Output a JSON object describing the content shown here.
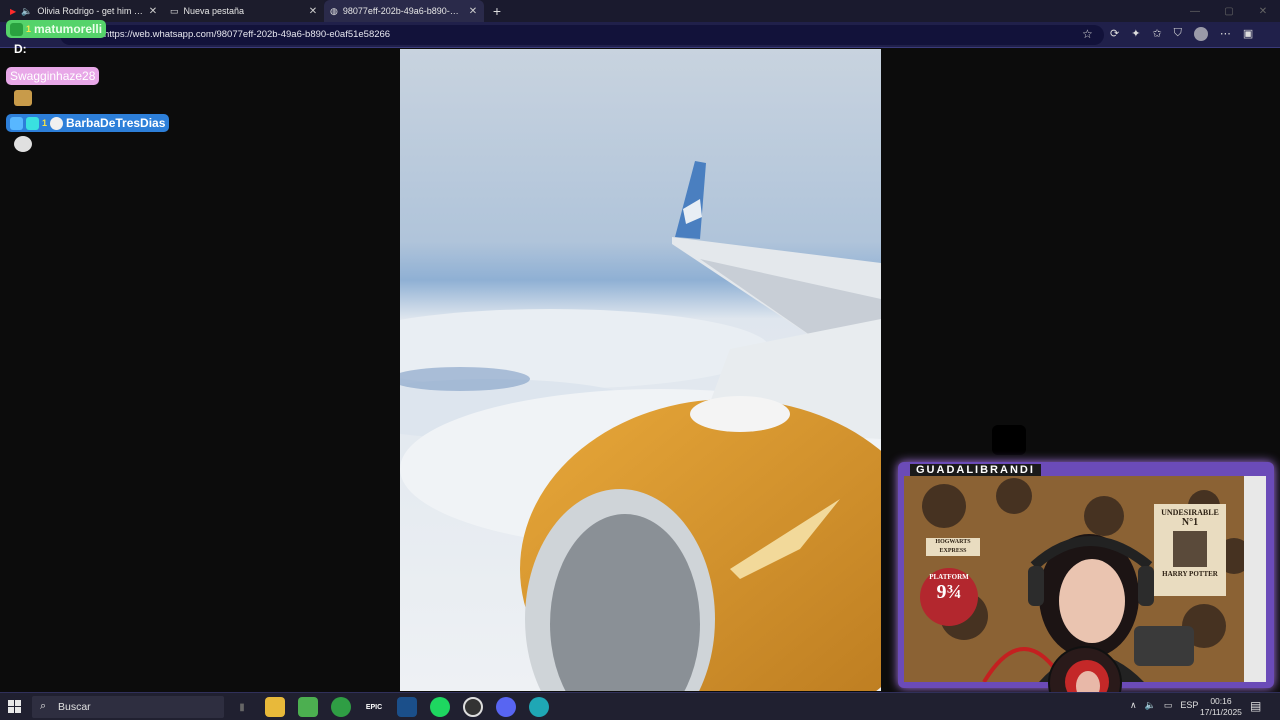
{
  "browser": {
    "tabs": [
      {
        "title": "Olivia Rodrigo - get him bac",
        "favicon": "youtube-icon",
        "audio": true
      },
      {
        "title": "Nueva pestaña",
        "favicon": "newtab-icon"
      },
      {
        "title": "98077eff-202b-49a6-b890-e0af5",
        "favicon": "globe-icon"
      }
    ],
    "new_tab": "+",
    "url": "https://web.whatsapp.com/98077eff-202b-49a6-b890-e0af51e58266"
  },
  "chat": {
    "top_marker": "D:",
    "messages": [
      {
        "user": "matumorelli",
        "badge_count": "1",
        "color": "#55d36a"
      },
      {
        "user": "Swagginhaze28",
        "color": "#e8a8e8"
      },
      {
        "user": "BarbaDeTresDias",
        "badge_count": "1",
        "color": "#2d7fd9"
      }
    ]
  },
  "webcam": {
    "streamer_name": "GUADALIBRANDI",
    "poster_title": "UNDESIRABLE",
    "poster_no": "N°1",
    "poster_name": "HARRY POTTER",
    "sign_hogwarts": "HOGWARTS EXPRESS",
    "platform_label": "PLATFORM",
    "platform_number": "9¾"
  },
  "taskbar": {
    "search_placeholder": "Buscar",
    "apps": [
      "file-explorer-icon",
      "minecraft-icon",
      "xbox-icon",
      "epic-games-icon",
      "steam-icon",
      "spotify-icon",
      "obs-icon",
      "discord-icon",
      "edge-icon"
    ],
    "epic_label": "EPIC",
    "language": "ESP",
    "time": "00:16",
    "date": "17/11/2025"
  },
  "colors": {
    "accent": "#3a3a7a",
    "taskbar": "#202030",
    "cam_border": "#b07cf0"
  }
}
